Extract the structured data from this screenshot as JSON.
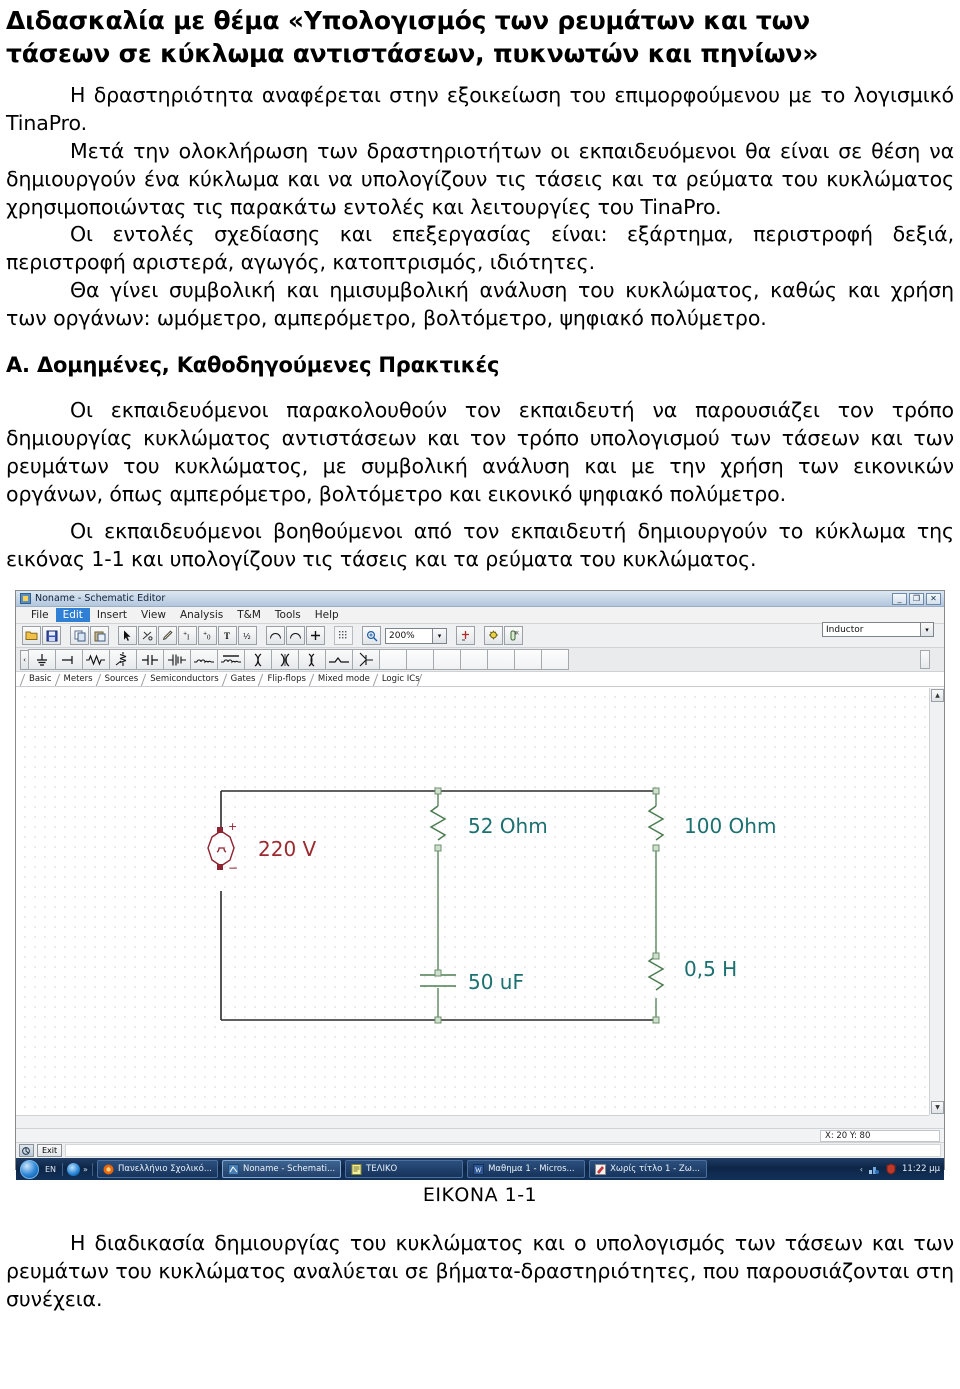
{
  "document": {
    "title_line1": "Διδασκαλία με θέμα «Υπολογισμός των ρευμάτων και των",
    "title_line2": "τάσεων σε κύκλωμα αντιστάσεων, πυκνωτών και πηνίων»",
    "paragraph1": "Η δραστηριότητα αναφέρεται στην εξοικείωση του επιμορφούμενου με το λογισμικό TinaPro.",
    "paragraph2": "Μετά την ολοκλήρωση των δραστηριοτήτων οι εκπαιδευόμενοι θα είναι σε θέση να δημιουργούν ένα κύκλωμα και να υπολογίζουν τις τάσεις και τα ρεύματα του κυκλώματος χρησιμοποιώντας τις παρακάτω εντολές και λειτουργίες του TinaPro.",
    "paragraph3": "Οι εντολές σχεδίασης και επεξεργασίας είναι: εξάρτημα, περιστροφή δεξιά, περιστροφή αριστερά, αγωγός,  κατοπτρισμός, ιδιότητες.",
    "paragraph4": "Θα γίνει συμβολική και ημισυμβολική ανάλυση του κυκλώματος, καθώς και χρήση των οργάνων: ωμόμετρο, αμπερόμετρο, βολτόμετρο, ψηφιακό πολύμετρο.",
    "section_a_heading": "Α. Δομημένες, Καθοδηγούμενες Πρακτικές",
    "paragraph5": "Οι εκπαιδευόμενοι παρακολουθούν τον εκπαιδευτή να παρουσιάζει τον τρόπο δημιουργίας κυκλώματος αντιστάσεων και τον τρόπο υπολογισμού των τάσεων και των ρευμάτων του κυκλώματος, με συμβολική ανάλυση και με την χρήση των εικονικών οργάνων, όπως αμπερόμετρο, βολτόμετρο και εικονικό ψηφιακό πολύμετρο.",
    "paragraph6": "Οι εκπαιδευόμενοι βοηθούμενοι από τον εκπαιδευτή δημιουργούν το κύκλωμα της εικόνας 1-1 και υπολογίζουν τις τάσεις και τα ρεύματα του κυκλώματος.",
    "figure_caption": "ΕΙΚΟΝΑ 1-1",
    "paragraph7": "Η διαδικασία δημιουργίας του κυκλώματος και ο υπολογισμός των τάσεων και των ρευμάτων του κυκλώματος αναλύεται σε βήματα-δραστηριότητες, που παρουσιάζονται στη συνέχεια."
  },
  "app_window": {
    "titlebar": {
      "title": "Noname - Schematic Editor",
      "icon": "app-icon",
      "minimize": "_",
      "restore": "❐",
      "close": "✕"
    },
    "menu": [
      {
        "label": "File",
        "active": false
      },
      {
        "label": "Edit",
        "active": true
      },
      {
        "label": "Insert",
        "active": false
      },
      {
        "label": "View",
        "active": false
      },
      {
        "label": "Analysis",
        "active": false
      },
      {
        "label": "T&M",
        "active": false
      },
      {
        "label": "Tools",
        "active": false
      },
      {
        "label": "Help",
        "active": false
      }
    ],
    "toolbar": {
      "buttons": [
        {
          "name": "open-folder-icon",
          "glyph": "🗁"
        },
        {
          "name": "save-icon",
          "glyph": "▤"
        },
        {
          "name": "copy-icon",
          "glyph": "❐"
        },
        {
          "name": "paste-icon",
          "glyph": "❏"
        },
        {
          "name": "select-arrow-icon",
          "glyph": "➤"
        },
        {
          "name": "delete-icon",
          "glyph": "✄"
        },
        {
          "name": "pencil-icon",
          "glyph": "✎"
        },
        {
          "name": "label-node-icon",
          "glyph": "ᴵ"
        },
        {
          "name": "label-zero-icon",
          "glyph": "⁰"
        },
        {
          "name": "text-tool-icon",
          "glyph": "T"
        },
        {
          "name": "half-scale-icon",
          "glyph": "½"
        },
        {
          "name": "arc-up-icon",
          "glyph": "⌒"
        },
        {
          "name": "arc-down-icon",
          "glyph": "⌒"
        },
        {
          "name": "cross-wire-icon",
          "glyph": "+"
        },
        {
          "name": "grid-icon",
          "glyph": "▦"
        },
        {
          "name": "zoom-icon",
          "glyph": "⌕"
        }
      ],
      "zoom_value": "200%",
      "zoom_arrow": "▾",
      "after_zoom_buttons": [
        {
          "name": "add-component-icon",
          "glyph": "✚"
        },
        {
          "name": "analysis-run-icon",
          "glyph": "✷"
        },
        {
          "name": "ic-probe-icon",
          "glyph": "▯"
        }
      ]
    },
    "component_bar": {
      "scroll_left": "‹",
      "components": [
        {
          "name": "ground-symbol-icon"
        },
        {
          "name": "terminal-symbol-icon"
        },
        {
          "name": "resistor-symbol-icon"
        },
        {
          "name": "potentiometer-symbol-icon"
        },
        {
          "name": "capacitor-symbol-icon"
        },
        {
          "name": "polarized-capacitor-symbol-icon"
        },
        {
          "name": "inductor-symbol-icon"
        },
        {
          "name": "coupled-inductor-symbol-icon"
        },
        {
          "name": "transformer-1-symbol-icon"
        },
        {
          "name": "transformer-2-symbol-icon"
        },
        {
          "name": "transformer-3-symbol-icon"
        },
        {
          "name": "diode-symbol-icon"
        },
        {
          "name": "transistor-symbol-icon"
        },
        {
          "name": "empty-slot-1"
        },
        {
          "name": "empty-slot-2"
        },
        {
          "name": "empty-slot-3"
        },
        {
          "name": "empty-slot-4"
        },
        {
          "name": "empty-slot-5"
        },
        {
          "name": "empty-slot-6"
        },
        {
          "name": "empty-slot-7"
        }
      ],
      "selected_component": "Inductor",
      "selected_component_arrow": "▾"
    },
    "category_tabs": [
      "Basic",
      "Meters",
      "Sources",
      "Semiconductors",
      "Gates",
      "Flip-flops",
      "Mixed mode",
      "Logic ICs"
    ],
    "statusbar": {
      "coordinates": "X: 20  Y: 80"
    },
    "bottom_bar": {
      "exit_label": "Exit",
      "exit_icon": "app-exit-icon"
    },
    "scrollbars": {
      "up_arrow": "▲",
      "down_arrow": "▼"
    }
  },
  "circuit": {
    "title": "RLC circuit",
    "colors": {
      "wire": "#2b2b2b",
      "label": "#1d7070",
      "source": "#8f2331",
      "node": "#7aa87a"
    },
    "components": [
      {
        "name": "voltage-source",
        "label": "220 V",
        "symbol": "ac-step-source",
        "plus": "+",
        "minus": "-"
      },
      {
        "name": "resistor-r1",
        "label": "52 Ohm",
        "symbol": "resistor"
      },
      {
        "name": "resistor-r2",
        "label": "100 Ohm",
        "symbol": "resistor"
      },
      {
        "name": "capacitor-c1",
        "label": "50 uF",
        "symbol": "capacitor"
      },
      {
        "name": "inductor-l1",
        "label": "0,5 H",
        "symbol": "inductor"
      }
    ]
  },
  "taskbar": {
    "start_button": "start-orb",
    "language": "EN",
    "quick_launch": [
      {
        "name": "internet-explorer-icon"
      },
      {
        "name": "show-more-chevron",
        "glyph": "»"
      }
    ],
    "windows": [
      {
        "label": "Πανελλήνιο Σχολικό...",
        "icon": "firefox-icon",
        "active": false
      },
      {
        "label": "Noname - Schemati...",
        "icon": "tinapro-icon",
        "active": true
      },
      {
        "label": "ΤΕΛΙΚΟ",
        "icon": "document-icon",
        "active": false
      },
      {
        "label": "Μαθημα 1 - Micros...",
        "icon": "word-icon",
        "active": false
      },
      {
        "label": "Χωρίς τίτλο 1 - Ζω...",
        "icon": "paint-icon",
        "active": false
      }
    ],
    "tray": {
      "expand": "‹",
      "icons": [
        "network-icon",
        "security-icon"
      ],
      "clock": "11:22 μμ"
    }
  }
}
